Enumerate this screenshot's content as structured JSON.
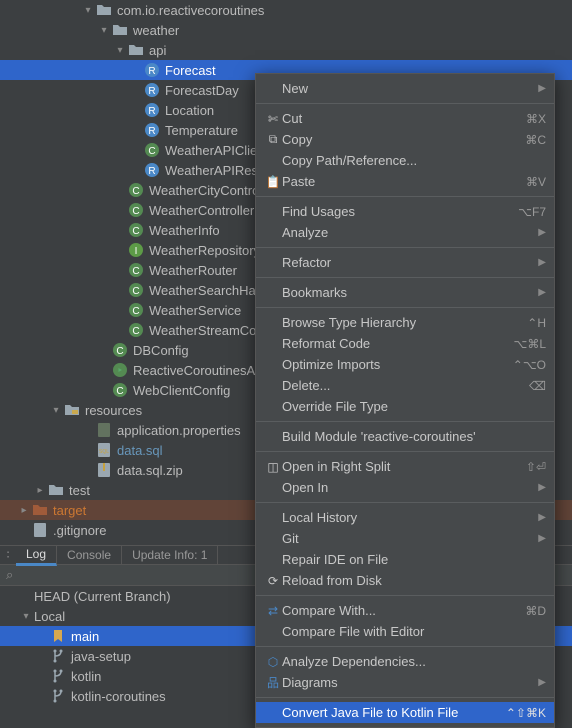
{
  "tree": {
    "rootPkg": "com.io.reactivecoroutines",
    "weather": "weather",
    "api": "api",
    "forecast": "Forecast",
    "forecastDay": "ForecastDay",
    "location": "Location",
    "temperature": "Temperature",
    "weatherApiClient": "WeatherAPIClie",
    "weatherApiResponse": "WeatherAPIRes",
    "weatherCityController": "WeatherCityControl",
    "weatherController": "WeatherController",
    "weatherInfo": "WeatherInfo",
    "weatherRepository": "WeatherRepository",
    "weatherRouter": "WeatherRouter",
    "weatherSearchHandler": "WeatherSearchHan",
    "weatherService": "WeatherService",
    "weatherStreamController": "WeatherStreamCon",
    "dbConfig": "DBConfig",
    "reactiveApp": "ReactiveCoroutinesAp",
    "webClientConfig": "WebClientConfig",
    "resources": "resources",
    "appProps": "application.properties",
    "dataSql": "data.sql",
    "dataSqlZip": "data.sql.zip",
    "test": "test",
    "target": "target",
    "gitignore": ".gitignore"
  },
  "tabs": {
    "log": "Log",
    "console": "Console",
    "updateInfo": "Update Info: 1"
  },
  "branches": {
    "head": "HEAD (Current Branch)",
    "local": "Local",
    "main": "main",
    "javaSetup": "java-setup",
    "kotlin": "kotlin",
    "kotlinCoroutines": "kotlin-coroutines"
  },
  "menu": {
    "new": "New",
    "cut": "Cut",
    "cutKey": "⌘X",
    "copy": "Copy",
    "copyKey": "⌘C",
    "copyPath": "Copy Path/Reference...",
    "paste": "Paste",
    "pasteKey": "⌘V",
    "findUsages": "Find Usages",
    "findUsagesKey": "⌥F7",
    "analyze": "Analyze",
    "refactor": "Refactor",
    "bookmarks": "Bookmarks",
    "browseHierarchy": "Browse Type Hierarchy",
    "browseHierarchyKey": "⌃H",
    "reformat": "Reformat Code",
    "reformatKey": "⌥⌘L",
    "optimize": "Optimize Imports",
    "optimizeKey": "⌃⌥O",
    "delete": "Delete...",
    "deleteKey": "⌫",
    "override": "Override File Type",
    "build": "Build Module 'reactive-coroutines'",
    "splitRight": "Open in Right Split",
    "splitRightKey": "⇧⏎",
    "openIn": "Open In",
    "localHistory": "Local History",
    "git": "Git",
    "repair": "Repair IDE on File",
    "reload": "Reload from Disk",
    "compareWith": "Compare With...",
    "compareWithKey": "⌘D",
    "compareEditor": "Compare File with Editor",
    "analyzeDeps": "Analyze Dependencies...",
    "diagrams": "Diagrams",
    "convert": "Convert Java File to Kotlin File",
    "convertKey": "⌃⇧⌘K"
  }
}
